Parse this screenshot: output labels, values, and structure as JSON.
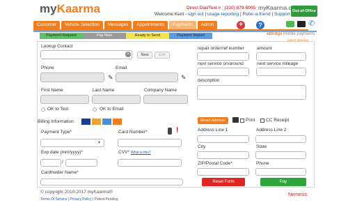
{
  "header": {
    "logo_my": "my",
    "logo_kaarma": "Kaarma",
    "direct_dial": "Direct Dial/Text # : (310) 879-5005",
    "site": "myKaarma.com",
    "welcome": "Welcome Kent -",
    "signout": "sign out",
    "usage_reporting": "usage reporting",
    "refer": "Refer-a-friend",
    "support": "Support",
    "status_badge": "Out-of-Office"
  },
  "nav": {
    "tabs": [
      "Customer",
      "Vehicle Selection",
      "Messages",
      "Appointments",
      "Payments",
      "Admin"
    ],
    "active": "Payments"
  },
  "icons": [
    "plus-icon",
    "help-icon",
    "chat-icon",
    "mail-icon",
    "phone-icon"
  ],
  "subtabs": [
    {
      "label": "Payment Request",
      "color": "#5cc268"
    },
    {
      "label": "Pay Now",
      "color": "#9a9a9a"
    },
    {
      "label": "Ready to Send",
      "color": "#f2e54f"
    },
    {
      "label": "Payment Report",
      "color": "#5a9be0"
    }
  ],
  "ebridge": {
    "brand": "eBridge",
    "tagline": "mobile payments",
    "patent": "patent pending"
  },
  "left": {
    "lookup_label": "Lookup Contact",
    "new_btn": "New",
    "edit_btn": "Edit",
    "phone_label": "Phone",
    "email_label": "Email",
    "first_label": "First Name",
    "last_label": "Last Name",
    "company_label": "Company Name",
    "ok_text": "OK to Text",
    "ok_email": "OK to Email",
    "billing_label": "Billing Information:",
    "payment_type_label": "Payment Type*",
    "card_number_label": "Card Number*",
    "exp_label": "Exp date (mm/yyyy)*",
    "slash": "/",
    "cvv_label": "CVV*",
    "whats_this": "What is this?",
    "cardholder_label": "Cardholder Name*"
  },
  "right": {
    "ro_label": "repair order/ref number",
    "amount_label": "amount",
    "next_service_label": "next service on/around",
    "next_mileage_label": "next service mileage",
    "description_label": "description",
    "reset_address": "Reset Address",
    "print_label": "Print",
    "cc_receipt_label": "CC Receipt",
    "addr1_label": "Address Line 1",
    "addr2_label": "Address Line 2",
    "city_label": "City",
    "state_label": "State",
    "zip_label": "ZIP/Postal Code*",
    "phone_label": "Phone",
    "reset_form": "Reset Form",
    "pay": "Pay"
  },
  "footer": {
    "copyright": "© copyright 2010-2017 myKaarma®",
    "terms": "Terms Of Service",
    "privacy": "Privacy Policy",
    "patent": "Patent Pending",
    "nemesis": "Nemesis"
  }
}
